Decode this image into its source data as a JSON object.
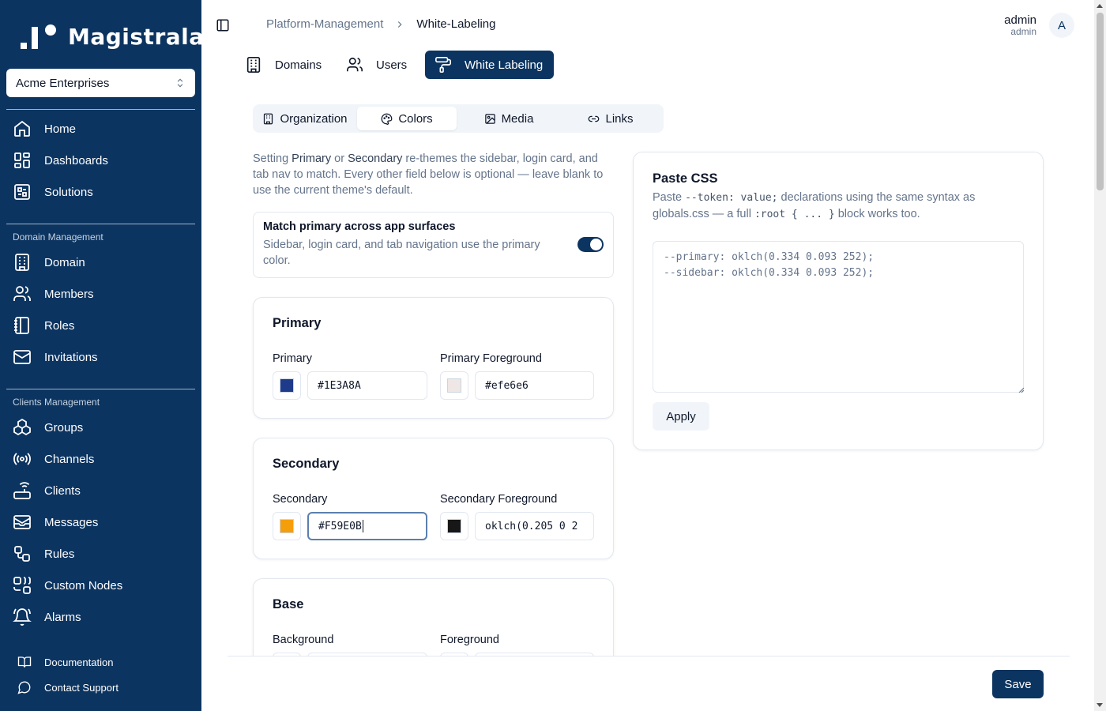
{
  "app": {
    "logo_text": "Magistrala"
  },
  "org_select": {
    "value": "Acme Enterprises"
  },
  "sidebar": {
    "top_items": [
      {
        "label": "Home",
        "icon": "home-icon"
      },
      {
        "label": "Dashboards",
        "icon": "dashboard-icon"
      },
      {
        "label": "Solutions",
        "icon": "solutions-icon"
      }
    ],
    "domain_section": "Domain Management",
    "domain_items": [
      {
        "label": "Domain",
        "icon": "building-icon"
      },
      {
        "label": "Members",
        "icon": "users-icon"
      },
      {
        "label": "Roles",
        "icon": "notebook-icon"
      },
      {
        "label": "Invitations",
        "icon": "mail-icon"
      }
    ],
    "clients_section": "Clients Management",
    "clients_items": [
      {
        "label": "Groups",
        "icon": "boxes-icon"
      },
      {
        "label": "Channels",
        "icon": "radio-icon"
      },
      {
        "label": "Clients",
        "icon": "router-icon"
      },
      {
        "label": "Messages",
        "icon": "mailbox-icon"
      },
      {
        "label": "Rules",
        "icon": "workflow-icon"
      },
      {
        "label": "Custom Nodes",
        "icon": "nodes-icon"
      },
      {
        "label": "Alarms",
        "icon": "bell-icon"
      }
    ],
    "footer_items": [
      {
        "label": "Documentation",
        "icon": "book-icon"
      },
      {
        "label": "Contact Support",
        "icon": "chat-icon"
      }
    ]
  },
  "breadcrumb": {
    "parent": "Platform-Management",
    "current": "White-Labeling"
  },
  "user": {
    "name": "admin",
    "role": "admin",
    "avatar_initial": "A"
  },
  "main_tabs": [
    {
      "label": "Domains",
      "icon": "building-icon"
    },
    {
      "label": "Users",
      "icon": "users-icon"
    },
    {
      "label": "White Labeling",
      "icon": "paint-roller-icon",
      "active": true
    }
  ],
  "sub_tabs": [
    {
      "label": "Organization",
      "icon": "building-icon"
    },
    {
      "label": "Colors",
      "icon": "palette-icon",
      "active": true
    },
    {
      "label": "Media",
      "icon": "image-icon"
    },
    {
      "label": "Links",
      "icon": "link-icon"
    }
  ],
  "intro": {
    "p1": "Setting ",
    "primary": "Primary",
    "p2": " or ",
    "secondary": "Secondary",
    "p3": " re-themes the sidebar, login card, and tab nav to match. Every other field below is optional — leave blank to use the current theme's default."
  },
  "match_primary": {
    "title": "Match primary across app surfaces",
    "description": "Sidebar, login card, and tab navigation use the primary color.",
    "enabled": true
  },
  "sections": {
    "primary": {
      "title": "Primary",
      "fields": [
        {
          "label": "Primary",
          "value": "#1E3A8A",
          "swatch": "#1E3A8A"
        },
        {
          "label": "Primary Foreground",
          "value": "#efe6e6",
          "swatch": "#efe6e6"
        }
      ]
    },
    "secondary": {
      "title": "Secondary",
      "fields": [
        {
          "label": "Secondary",
          "value": "#F59E0B",
          "swatch": "#F59E0B"
        },
        {
          "label": "Secondary Foreground",
          "value": "oklch(0.205 0 2",
          "swatch": "#171717"
        }
      ]
    },
    "base": {
      "title": "Base",
      "fields": [
        {
          "label": "Background"
        },
        {
          "label": "Foreground"
        }
      ]
    }
  },
  "paste_css": {
    "title": "Paste CSS",
    "desc_1": "Paste ",
    "desc_code_1": "--token: value;",
    "desc_2": " declarations using the same syntax as globals.css — a full ",
    "desc_code_2": ":root { ... }",
    "desc_3": " block works too.",
    "placeholder": "--primary: oklch(0.334 0.093 252);\n--sidebar: oklch(0.334 0.093 252);",
    "apply_label": "Apply"
  },
  "footer": {
    "save_label": "Save"
  },
  "colors": {
    "sidebar_bg": "#0c3460",
    "accent": "#0c3460"
  }
}
